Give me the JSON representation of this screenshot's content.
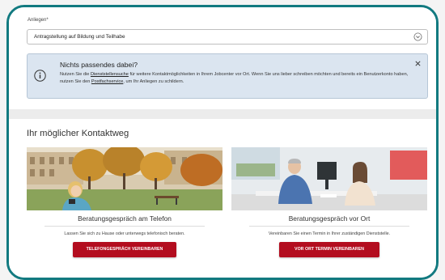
{
  "form": {
    "label": "Anliegen*",
    "select_value": "Antragstellung auf Bildung und Teilhabe"
  },
  "info": {
    "title": "Nichts passendes dabei?",
    "text_1": "Nutzen Sie die ",
    "link_1": "Dienststellensuche",
    "text_2": " für weitere Kontaktmöglichkeiten in Ihrem Jobcenter vor Ort. Wenn Sie uns lieber schreiben möchten und bereits ein Benutzerkonto haben, nutzen Sie den ",
    "link_2": "Postfachservice",
    "text_3": ", um Ihr Anliegen zu schildern."
  },
  "contact": {
    "title": "Ihr möglicher Kontaktweg",
    "cards": [
      {
        "title": "Beratungsgespräch am Telefon",
        "text": "Lassen Sie sich zu Hause oder unterwegs telefonisch beraten.",
        "button": "TELEFONGESPRÄCH VEREINBAREN"
      },
      {
        "title": "Beratungsgespräch vor Ort",
        "text": "Vereinbaren Sie einen Termin in Ihrer zuständigen Dienststelle.",
        "button": "VOR ORT TERMIN VEREINBAREN"
      }
    ]
  },
  "colors": {
    "frame": "#127a80",
    "info_bg": "#dbe5f0",
    "button": "#b30d1f"
  },
  "icons": [
    "chevron-down-icon",
    "info-icon",
    "close-icon"
  ]
}
